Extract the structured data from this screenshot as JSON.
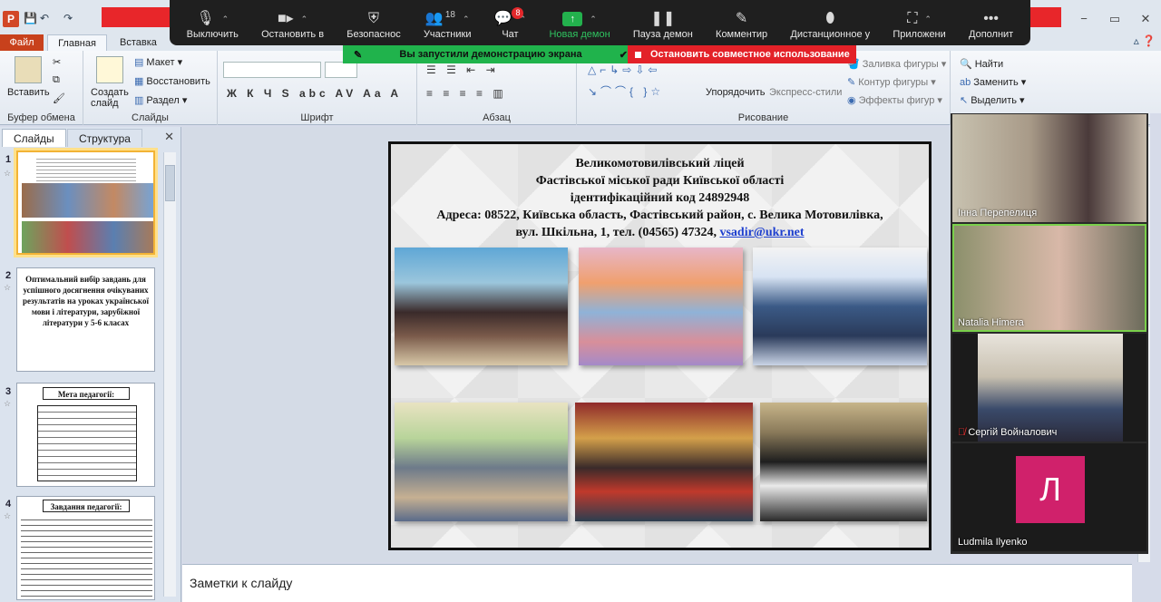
{
  "titlebar": {
    "app_letter": "P",
    "window_controls": [
      "−",
      "▭",
      "✕"
    ]
  },
  "zoom_toolbar": {
    "items": [
      {
        "label": "Выключить",
        "icon": "microphone-icon"
      },
      {
        "label": "Остановить в",
        "icon": "video-camera-icon"
      },
      {
        "label": "Безопаснос",
        "icon": "shield-icon"
      },
      {
        "label": "Участники",
        "icon": "participants-icon",
        "count": "18"
      },
      {
        "label": "Чат",
        "icon": "chat-icon",
        "badge": "8"
      },
      {
        "label": "Новая демон",
        "icon": "new-share-icon"
      },
      {
        "label": "Пауза демон",
        "icon": "pause-icon"
      },
      {
        "label": "Комментир",
        "icon": "annotate-pencil-icon"
      },
      {
        "label": "Дистанционное у",
        "icon": "remote-control-mouse-icon"
      },
      {
        "label": "Приложени",
        "icon": "apps-icon"
      },
      {
        "label": "Дополнит",
        "icon": "more-icon"
      }
    ]
  },
  "share_banner": {
    "status": "Вы запустили демонстрацию экрана",
    "stop": "Остановить совместное использование"
  },
  "ribbon": {
    "tabs": {
      "file": "Файл",
      "home": "Главная",
      "insert": "Вставка"
    },
    "clipboard": {
      "paste": "Вставить",
      "group": "Буфер обмена"
    },
    "slides": {
      "new_slide": "Создать слайд",
      "layout": "Макет",
      "reset": "Восстановить",
      "section": "Раздел",
      "group": "Слайды"
    },
    "font": {
      "group": "Шрифт"
    },
    "paragraph": {
      "group": "Абзац"
    },
    "drawing": {
      "arrange": "Упорядочить",
      "quick_styles": "Экспресс-стили",
      "fill": "Заливка фигуры",
      "outline": "Контур фигуры",
      "effects": "Эффекты фигур",
      "group": "Рисование"
    },
    "editing": {
      "find": "Найти",
      "replace": "Заменить",
      "select": "Выделить"
    }
  },
  "slides_panel": {
    "tabs": {
      "slides": "Слайды",
      "outline": "Структура"
    },
    "thumbs": [
      {
        "num": "1",
        "text": ""
      },
      {
        "num": "2",
        "text": "Оптимальний вибір завдань для успішного досягнення очікуваних результатів на уроках української мови і літератури, зарубіжної літератури у 5-6 класах"
      },
      {
        "num": "3",
        "text": "Мета педагогії:"
      },
      {
        "num": "4",
        "text": "Завдання педагогії:"
      }
    ]
  },
  "slide": {
    "line1": "Великомотовилівський ліцей",
    "line2": "Фастівської міської  ради Київської області",
    "line3": "ідентифікаційний код 24892948",
    "line4": "Адреса: 08522, Київська область, Фастівський район, с. Велика Мотовилівка,",
    "line5": "вул. Шкільна, 1, тел. (04565) 47324, ",
    "email": "vsadir@ukr.net"
  },
  "notes": {
    "placeholder": "Заметки к слайду"
  },
  "participants": [
    {
      "name": "Інна Перепелиця"
    },
    {
      "name": "Natalia Himera"
    },
    {
      "name": "Сергій Войналович"
    },
    {
      "name": "Ludmila Ilyenko",
      "initial": "Л"
    }
  ],
  "colors": {
    "zoom_red": "#e8262a",
    "share_green": "#20b34c",
    "avatar": "#d0216b"
  }
}
